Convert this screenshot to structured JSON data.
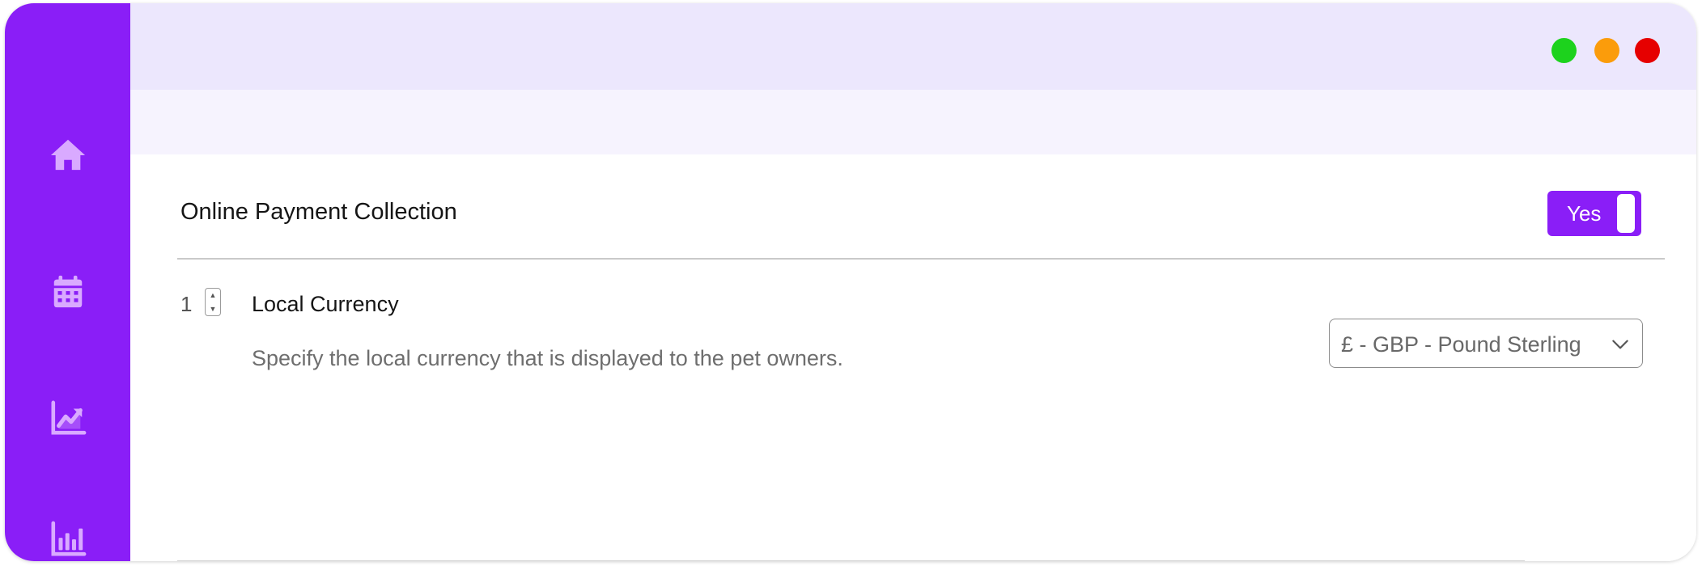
{
  "window": {
    "controls": [
      {
        "name": "maximize",
        "color": "#1dd21d"
      },
      {
        "name": "minimize",
        "color": "#fb9c0b"
      },
      {
        "name": "close",
        "color": "#e60000"
      }
    ]
  },
  "sidebar": {
    "background": "#8a1ef7",
    "icon_color": "#d9aaff",
    "items": [
      {
        "icon": "home-icon"
      },
      {
        "icon": "calendar-icon"
      },
      {
        "icon": "line-chart-icon"
      },
      {
        "icon": "bar-chart-icon"
      }
    ]
  },
  "settings": {
    "section_title": "Online Payment Collection",
    "toggle": {
      "label": "Yes",
      "state": "on"
    },
    "rows": [
      {
        "number": "1",
        "title": "Local Currency",
        "description": "Specify the local currency that is displayed to the pet owners.",
        "select_value": "£ - GBP - Pound Sterling"
      }
    ]
  }
}
